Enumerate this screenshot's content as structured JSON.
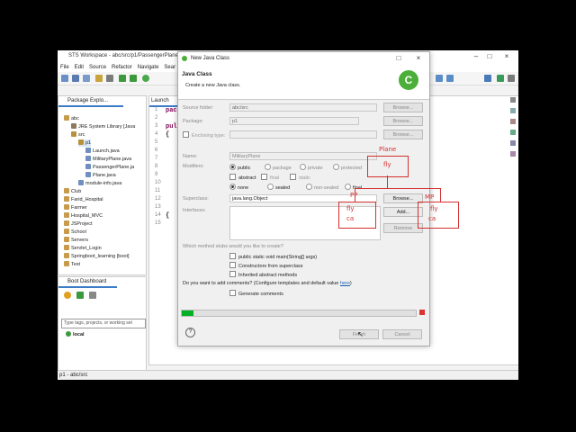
{
  "window": {
    "title": "STS Workspace - abc/src/p1/PassengerPlane.ja"
  },
  "menu": [
    "File",
    "Edit",
    "Source",
    "Refactor",
    "Navigate",
    "Sear"
  ],
  "package_explorer": {
    "tab": "Package Explo...",
    "tree": [
      "abc",
      "JRE System Library [Java",
      "src",
      "p1",
      "Launch.java",
      "MilitaryPlane.java",
      "PassengerPlane.ja",
      "Plane.java",
      "module-info.java",
      "Club",
      "Farid_Hospital",
      "Farmer",
      "Hospital_MVC",
      "JSProject",
      "School",
      "Servers",
      "Servlet_Login",
      "Springboot_learning [boot]",
      "Test"
    ]
  },
  "boot_dashboard": {
    "tab": "Boot Dashboard",
    "search_placeholder": "Type tags, projects, or working set",
    "local": "local"
  },
  "editor": {
    "tab": "Launch",
    "line_numbers": [
      "1",
      "2",
      "3",
      "4",
      "5",
      "6",
      "7",
      "8",
      "9",
      "10",
      "11",
      "12",
      "13",
      "14",
      "15"
    ],
    "code_lines": [
      "pac",
      "",
      "pul",
      "{",
      ""
    ]
  },
  "statusbar": "p1 - abc/src",
  "dialog": {
    "window_title": "New Java Class",
    "heading": "Java Class",
    "subheading": "Create a new Java class.",
    "source_folder_label": "Source folder:",
    "source_folder_value": "abc/src",
    "package_label": "Package:",
    "package_value": "p1",
    "enclosing_label": "Enclosing type:",
    "name_label": "Name:",
    "name_value": "MilitaryPlane",
    "modifiers_label": "Modifiers:",
    "modifiers": [
      "public",
      "package",
      "private",
      "protected",
      "abstract",
      "final",
      "static",
      "none",
      "sealed",
      "non-sealed",
      "final"
    ],
    "superclass_label": "Superclass:",
    "superclass_value": "java.lang.Object",
    "interfaces_label": "Interfaces:",
    "browse": "Browse...",
    "add": "Add...",
    "remove": "Remove",
    "stubs_question": "Which method stubs would you like to create?",
    "stub_options": [
      "public static void main(String[] args)",
      "Constructors from superclass",
      "Inherited abstract methods"
    ],
    "comments_question_pre": "Do you want to add comments? (Configure templates and default value ",
    "comments_link": "here",
    "comments_question_post": ")",
    "generate_comments": "Generate comments",
    "progress": 0.05,
    "finish": "Finish",
    "cancel": "Cancel",
    "help": "?"
  },
  "annotations": {
    "plane": "Plane",
    "fly1": "fly",
    "pp": "PP",
    "fly2": "fly",
    "ca1": "ca",
    "mp": "MP",
    "fly3": "fly",
    "ca2": "ca"
  },
  "colors": {
    "accent": "#3c7cc6",
    "progress": "#06b025",
    "annotation": "#d43030",
    "logo": "#4caf3a"
  }
}
